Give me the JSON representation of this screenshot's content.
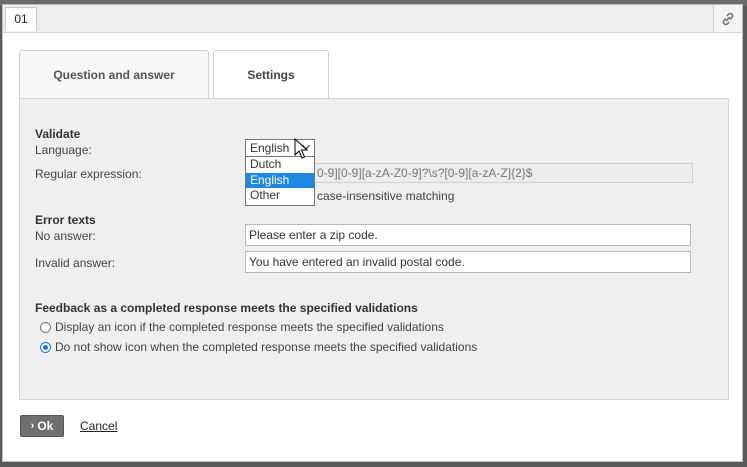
{
  "window": {
    "tab_id": "01",
    "link_icon": "link-icon"
  },
  "tabs": [
    {
      "label": "Question and answer",
      "active": false
    },
    {
      "label": "Settings",
      "active": true
    }
  ],
  "validate": {
    "heading": "Validate",
    "language_label": "Language:",
    "language_value": "English",
    "language_options": [
      "Dutch",
      "English",
      "Other"
    ],
    "regex_label": "Regular expression:",
    "regex_value": "^[1-9][0-9]{3}\\s?[A-Za-z]{2}$|^[0-9][a-zA-Z0-9]?\\s?[0-9][a-zA-Z]{2}$",
    "regex_visible_tail": "0-9][0-9][a-zA-Z0-9]?\\s?[0-9][a-zA-Z]{2}$",
    "case_label": "case-insensitive matching"
  },
  "errors": {
    "heading": "Error texts",
    "no_answer_label": "No answer:",
    "no_answer_value": "Please enter a zip code.",
    "invalid_label": "Invalid answer:",
    "invalid_value": "You have entered an invalid postal code."
  },
  "feedback": {
    "heading": "Feedback as a completed response meets the specified validations",
    "options": [
      {
        "label": "Display an icon if the completed response meets the specified validations",
        "checked": false
      },
      {
        "label": "Do not show icon when the completed response meets the specified validations",
        "checked": true
      }
    ]
  },
  "buttons": {
    "ok_label": "Ok",
    "ok_arrow": "›",
    "cancel_label": "Cancel"
  },
  "colors": {
    "accent": "#1e88e5",
    "ok_button": "#6f6f6f"
  }
}
